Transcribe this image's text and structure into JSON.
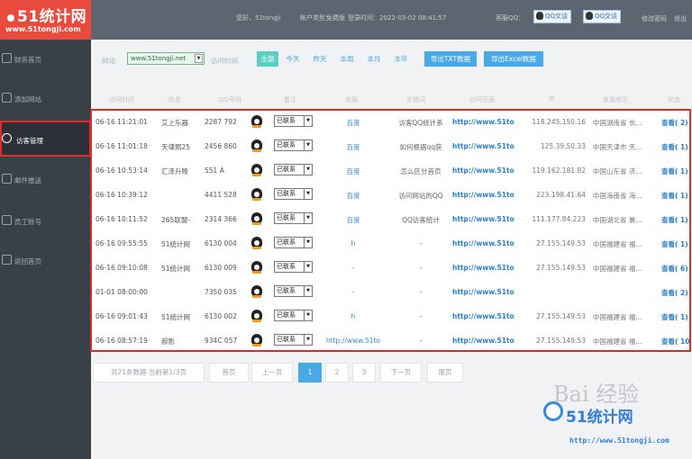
{
  "logo": {
    "main": "51统计网",
    "sub": "www.51tongji.com"
  },
  "header": {
    "welcome": "您好，51tongji",
    "account_type_label": "帐户类型：",
    "account_type": "免费版",
    "login_time": "登录时间：2022-03-02 08:41:57",
    "qq_label": "客服QQ：",
    "qq_buttons": [
      "QQ交谈",
      "QQ交谈"
    ],
    "modify_password": "修改密码",
    "logout": "退出"
  },
  "sidebar": {
    "items": [
      {
        "label": "财务首页",
        "icon": "home-icon"
      },
      {
        "label": "添加网站",
        "icon": "plus-icon"
      },
      {
        "label": "访客管理",
        "icon": "user-icon"
      },
      {
        "label": "邮件推送",
        "icon": "mail-icon"
      },
      {
        "label": "员工账号",
        "icon": "team-icon"
      },
      {
        "label": "返回首页",
        "icon": "return-icon"
      }
    ]
  },
  "filter": {
    "site_label": "网站",
    "site_value": "www.51tongji.net",
    "time_label": "访问时间",
    "periods": [
      "全部",
      "今天",
      "昨天",
      "本周",
      "本月",
      "本年"
    ],
    "export_txt": "导出TXT数据",
    "export_excel": "导出Excel数据"
  },
  "table": {
    "headers": [
      "访问时间",
      "姓名",
      "QQ号码",
      "备注",
      "来源",
      "关键词",
      "访问页面",
      "IP",
      "来源地区",
      "状态"
    ],
    "rows": [
      {
        "time": "06-16 11:21:01",
        "name": "艾上乐器",
        "qq": "2287  792",
        "status": "已联系",
        "source": "百度",
        "keyword": "访客QQ统计系",
        "url": "http://www.51to",
        "ip": "118.245.150.16",
        "location": "中国湖南省 长...",
        "view": "查看( 2)"
      },
      {
        "time": "06-16 11:01:18",
        "name": "天律照25",
        "qq": "2456  860",
        "status": "已联系",
        "source": "百度",
        "keyword": "如何根据qq获",
        "url": "http://www.51to",
        "ip": "125.39.50.33",
        "location": "中国天津市 天...",
        "view": "查看( 1)"
      },
      {
        "time": "06-16 10:53:14",
        "name": "汇泽升降",
        "qq": "551   A",
        "status": "已联系",
        "source": "百度",
        "keyword": "怎么区分首页",
        "url": "http://www.51to",
        "ip": "119.162.181.82",
        "location": "中国山东省 济...",
        "view": "查看( 1)"
      },
      {
        "time": "06-16 10:39:12",
        "name": "",
        "qq": "4411  528",
        "status": "已联系",
        "source": "百度",
        "keyword": "访问网站的QQ",
        "url": "http://www.51to",
        "ip": "223.198.41.64",
        "location": "中国海南省 海...",
        "view": "查看( 1)"
      },
      {
        "time": "06-16 10:11:52",
        "name": "265联盟-",
        "qq": "2314  366",
        "status": "已联系",
        "source": "百度",
        "keyword": "QQ访客统计",
        "url": "http://www.51to",
        "ip": "111.177.84.223",
        "location": "中国湖北省 襄...",
        "view": "查看( 1)"
      },
      {
        "time": "06-16 09:55:55",
        "name": "51统计网",
        "qq": "6130  004",
        "status": "已联系",
        "source": "h",
        "keyword": "-",
        "url": "http://www.51to",
        "ip": "27.155.149.53",
        "location": "中国福建省 福...",
        "view": "查看( 1)"
      },
      {
        "time": "06-16 09:10:08",
        "name": "51统计网",
        "qq": "6130  009",
        "status": "已联系",
        "source": "-",
        "keyword": "-",
        "url": "http://www.51to",
        "ip": "27.155.149.53",
        "location": "中国福建省 福...",
        "view": "查看( 6)"
      },
      {
        "time": "01-01 08:00:00",
        "name": "",
        "qq": "7350  035",
        "status": "已联系",
        "source": "-",
        "keyword": "-",
        "url": "http://www.51to",
        "ip": "",
        "location": "",
        "view": "查看( 2)"
      },
      {
        "time": "06-16 09:01:43",
        "name": "51统计网",
        "qq": "6130  002",
        "status": "已联系",
        "source": "h",
        "keyword": "-",
        "url": "http://www.51to",
        "ip": "27.155.149.53",
        "location": "中国福建省 福...",
        "view": "查看( 1)"
      },
      {
        "time": "06-16 08:57:19",
        "name": "郝影",
        "qq": "934C  057",
        "status": "已联系",
        "source": "http://www.51to",
        "keyword": "-",
        "url": "http://www.51to",
        "ip": "27.155.149.53",
        "location": "中国福建省 福...",
        "view": "查看( 10+"
      }
    ]
  },
  "pagination": {
    "summary": "共21条数据 当前第1/3页",
    "first": "首页",
    "prev": "上一页",
    "pages": [
      "1",
      "2",
      "3"
    ],
    "next": "下一页",
    "last": "尾页"
  },
  "watermark": {
    "text": "Bai 经验",
    "brand": "51统计网",
    "url": "http://www.51tongji.com"
  },
  "colors": {
    "accent_red": "#e02b2b",
    "brand_red": "#e84a3d",
    "link_blue": "#2a7fd0",
    "teal": "#5ccfc2",
    "sidebar": "#3a4048"
  }
}
